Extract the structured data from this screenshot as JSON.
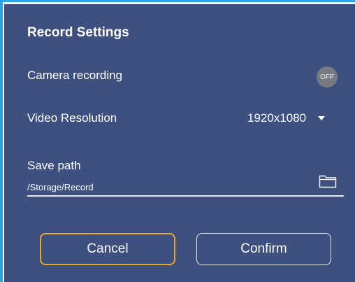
{
  "dialog": {
    "title": "Record Settings",
    "camera_recording": {
      "label": "Camera recording",
      "toggle_state": "OFF"
    },
    "video_resolution": {
      "label": "Video Resolution",
      "selected": "1920x1080"
    },
    "save_path": {
      "label": "Save path",
      "value": "/Storage/Record",
      "icon": "folder-icon"
    },
    "buttons": {
      "cancel": "Cancel",
      "confirm": "Confirm"
    }
  },
  "colors": {
    "dialog_background": "#3e5080",
    "accent": "#2aa3e8",
    "cancel_border": "#e8a72f",
    "toggle_off": "#777a80",
    "text": "#ffffff"
  }
}
